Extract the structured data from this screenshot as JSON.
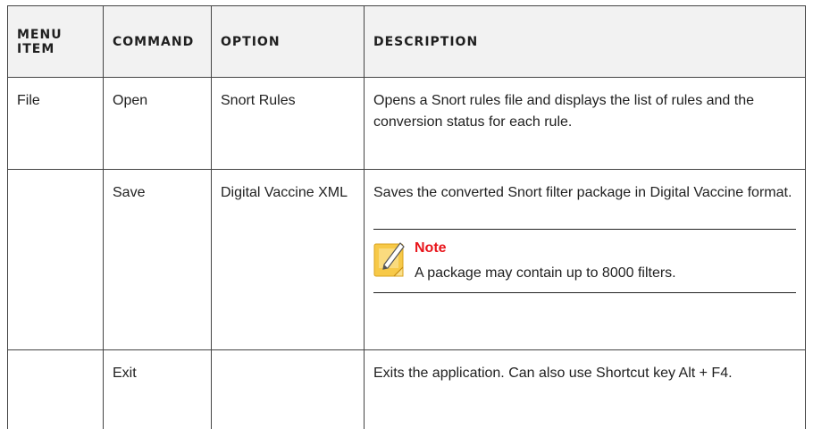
{
  "table": {
    "headers": {
      "menu_item": "Menu Item",
      "command": "Command",
      "option": "Option",
      "description": "Description"
    },
    "rows": [
      {
        "menu_item": "File",
        "command": "Open",
        "option": "Snort Rules",
        "description": "Opens a Snort rules file and displays the list of rules and the conversion status for each rule."
      },
      {
        "menu_item": "",
        "command": "Save",
        "option": "Digital Vaccine XML",
        "description": "Saves the converted Snort filter package in Digital Vaccine format.",
        "note": {
          "title": "Note",
          "body": "A package may contain up to 8000 filters.",
          "icon": "note-pencil-icon",
          "title_color": "#e8151b",
          "icon_color": "#f7c948"
        }
      },
      {
        "menu_item": "",
        "command": "Exit",
        "option": "",
        "description": "Exits the application. Can also use Shortcut key Alt + F4."
      }
    ]
  }
}
